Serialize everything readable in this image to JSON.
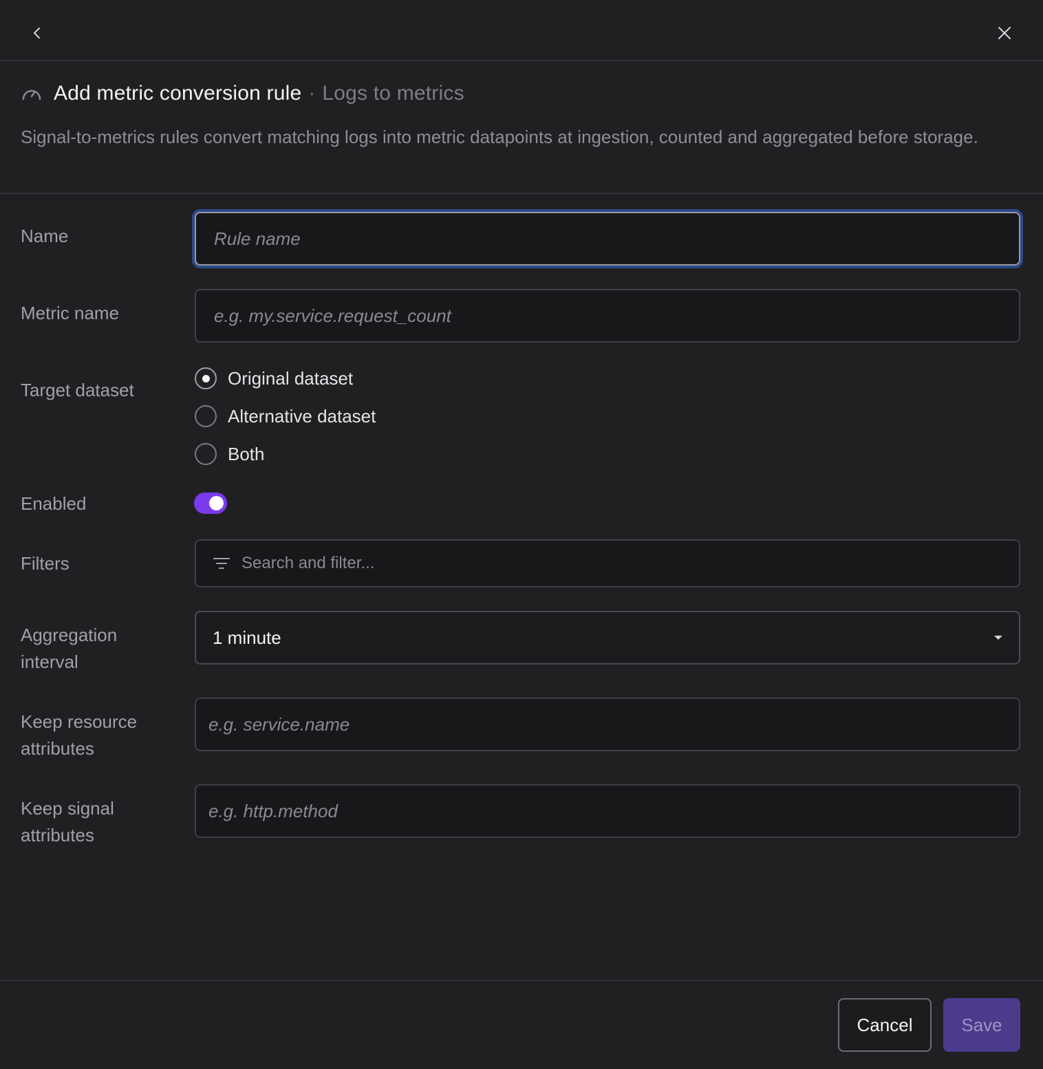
{
  "nav": {
    "back_icon": "chevron-left-icon",
    "close_icon": "close-icon"
  },
  "header": {
    "icon": "gauge-icon",
    "title": "Add metric conversion rule",
    "separator": "·",
    "subtitle": "Logs to metrics",
    "description": "Signal-to-metrics rules convert matching logs into metric datapoints at ingestion, counted and aggregated before storage."
  },
  "form": {
    "name": {
      "label": "Name",
      "placeholder": "Rule name",
      "value": ""
    },
    "metric_name": {
      "label": "Metric name",
      "placeholder": "e.g. my.service.request_count",
      "value": ""
    },
    "target_dataset": {
      "label": "Target dataset",
      "options": [
        "Original dataset",
        "Alternative dataset",
        "Both"
      ],
      "selected": "Original dataset"
    },
    "enabled": {
      "label": "Enabled",
      "value": true
    },
    "filters": {
      "label": "Filters",
      "placeholder": "Search and filter..."
    },
    "aggregation_interval": {
      "label_line1": "Aggregation",
      "label_line2": "interval",
      "value": "1 minute"
    },
    "keep_resource_attributes": {
      "label_line1": "Keep resource",
      "label_line2": "attributes",
      "placeholder": "e.g. service.name"
    },
    "keep_signal_attributes": {
      "label_line1": "Keep signal",
      "label_line2": "attributes",
      "placeholder": "e.g. http.method"
    }
  },
  "footer": {
    "cancel_label": "Cancel",
    "save_label": "Save"
  },
  "colors": {
    "accent": "#7c3aed",
    "save_button": "#4c3a8c",
    "focus_ring": "#2c4a8a",
    "background": "#202023"
  }
}
